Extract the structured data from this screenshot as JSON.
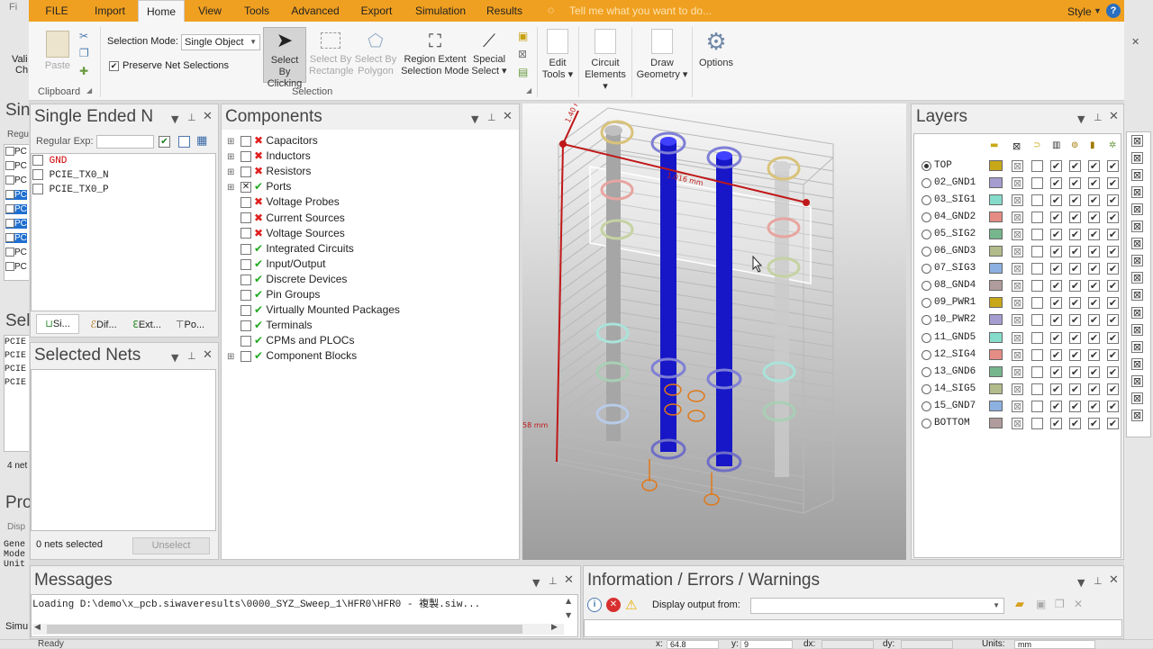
{
  "ribbon": {
    "file_tab": "FILE",
    "tabs": [
      "Import",
      "Home",
      "View",
      "Tools",
      "Advanced",
      "Export",
      "Simulation",
      "Results"
    ],
    "search_placeholder": "Tell me what you want to do...",
    "style_label": "Style",
    "help": "?",
    "clipboard": {
      "paste": "Paste",
      "group": "Clipboard"
    },
    "selection": {
      "mode_label": "Selection Mode:",
      "mode_value": "Single Object",
      "preserve_label": "Preserve Net Selections",
      "by_clicking_1": "Select By",
      "by_clicking_2": "Clicking",
      "by_rect_1": "Select By",
      "by_rect_2": "Rectangle",
      "by_poly_1": "Select By",
      "by_poly_2": "Polygon",
      "region_1": "Region Extent",
      "region_2": "Selection Mode",
      "special_1": "Special",
      "special_2": "Select ▾",
      "group": "Selection"
    },
    "edit_tools_1": "Edit",
    "edit_tools_2": "Tools ▾",
    "circuit_1": "Circuit",
    "circuit_2": "Elements ▾",
    "draw_1": "Draw",
    "draw_2": "Geometry ▾",
    "options": "Options"
  },
  "left_strip": {
    "items": [
      "Vali",
      "Ch",
      "Sin",
      "Regu",
      "PC",
      "PC",
      "PC",
      "PC",
      "PC",
      "PC",
      "PC",
      "PC",
      "PC",
      "Sel",
      "PCIE",
      "PCIE",
      "PCIE",
      "PCIE",
      "4 net",
      "Pro",
      "Disp",
      "Gene",
      "Mode",
      "Unit",
      "Simu",
      "Ready"
    ]
  },
  "single_ended": {
    "title": "Single Ended N",
    "regexp_label": "Regular Exp:",
    "nets": [
      {
        "name": "GND",
        "color": "#cc0000"
      },
      {
        "name": "PCIE_TX0_N",
        "color": "#222222"
      },
      {
        "name": "PCIE_TX0_P",
        "color": "#222222"
      }
    ],
    "tabs": [
      "Si...",
      "Dif...",
      "Ext...",
      "Po..."
    ]
  },
  "selected_nets": {
    "title": "Selected Nets",
    "status": "0 nets selected",
    "unselect": "Unselect"
  },
  "components": {
    "title": "Components",
    "items": [
      {
        "label": "Capacitors",
        "status": "x",
        "checked": false,
        "expandable": true
      },
      {
        "label": "Inductors",
        "status": "x",
        "checked": false,
        "expandable": true
      },
      {
        "label": "Resistors",
        "status": "x",
        "checked": false,
        "expandable": true
      },
      {
        "label": "Ports",
        "status": "ok",
        "checked": true,
        "expandable": true
      },
      {
        "label": "Voltage Probes",
        "status": "x",
        "checked": false,
        "expandable": false
      },
      {
        "label": "Current Sources",
        "status": "x",
        "checked": false,
        "expandable": false
      },
      {
        "label": "Voltage Sources",
        "status": "x",
        "checked": false,
        "expandable": false
      },
      {
        "label": "Integrated Circuits",
        "status": "ok",
        "checked": false,
        "expandable": false
      },
      {
        "label": "Input/Output",
        "status": "ok",
        "checked": false,
        "expandable": false
      },
      {
        "label": "Discrete Devices",
        "status": "ok",
        "checked": false,
        "expandable": false
      },
      {
        "label": "Pin Groups",
        "status": "ok",
        "checked": false,
        "expandable": false
      },
      {
        "label": "Virtually Mounted Packages",
        "status": "ok",
        "checked": false,
        "expandable": false
      },
      {
        "label": "Terminals",
        "status": "ok",
        "checked": false,
        "expandable": false
      },
      {
        "label": "CPMs and PLOCs",
        "status": "ok",
        "checked": false,
        "expandable": false
      },
      {
        "label": "Component Blocks",
        "status": "ok",
        "checked": false,
        "expandable": true
      }
    ]
  },
  "viewport": {
    "dim_top": "1.40 mm",
    "dim_mid": "1.016 mm",
    "dim_left": "58 mm"
  },
  "layers": {
    "title": "Layers",
    "items": [
      {
        "name": "TOP",
        "color": "#c8a818",
        "selected": true
      },
      {
        "name": "02_GND1",
        "color": "#a59ccf",
        "selected": false
      },
      {
        "name": "03_SIG1",
        "color": "#86dccb",
        "selected": false
      },
      {
        "name": "04_GND2",
        "color": "#e58c84",
        "selected": false
      },
      {
        "name": "05_SIG2",
        "color": "#76b68c",
        "selected": false
      },
      {
        "name": "06_GND3",
        "color": "#b2bc8b",
        "selected": false
      },
      {
        "name": "07_SIG3",
        "color": "#8cb0e0",
        "selected": false
      },
      {
        "name": "08_GND4",
        "color": "#b09c9c",
        "selected": false
      },
      {
        "name": "09_PWR1",
        "color": "#c8a818",
        "selected": false
      },
      {
        "name": "10_PWR2",
        "color": "#a59ccf",
        "selected": false
      },
      {
        "name": "11_GND5",
        "color": "#86dccb",
        "selected": false
      },
      {
        "name": "12_SIG4",
        "color": "#e58c84",
        "selected": false
      },
      {
        "name": "13_GND6",
        "color": "#76b68c",
        "selected": false
      },
      {
        "name": "14_SIG5",
        "color": "#b2bc8b",
        "selected": false
      },
      {
        "name": "15_GND7",
        "color": "#8cb0e0",
        "selected": false
      },
      {
        "name": "BOTTOM",
        "color": "#b09c9c",
        "selected": false
      }
    ]
  },
  "messages": {
    "title": "Messages",
    "line": "Loading D:\\demo\\x_pcb.siwaveresults\\0000_SYZ_Sweep_1\\HFR0\\HFR0 - 複製.siw..."
  },
  "info": {
    "title": "Information / Errors / Warnings",
    "display_label": "Display output from:"
  },
  "statusbar": {
    "x_label": "x:",
    "x_value": "64.8",
    "y_label": "y:",
    "y_value": "9",
    "dx_label": "dx:",
    "dy_label": "dy:",
    "units_label": "Units:",
    "units_value": "mm"
  }
}
